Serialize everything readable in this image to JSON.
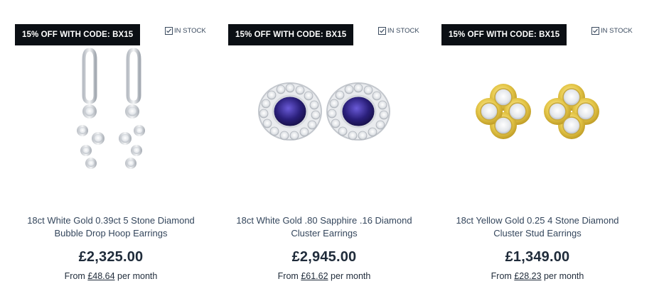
{
  "products": [
    {
      "badge": "15% OFF WITH CODE: BX15",
      "stock": "IN STOCK",
      "title_line1": "18ct White Gold 0.39ct 5 Stone Diamond",
      "title_line2": "Bubble Drop Hoop Earrings",
      "price": "£2,325.00",
      "finance_prefix": "From",
      "finance_amount": "£48.64",
      "finance_suffix": "per month",
      "image_icon": "drop-hoop-earrings-icon"
    },
    {
      "badge": "15% OFF WITH CODE: BX15",
      "stock": "IN STOCK",
      "title_line1": "18ct White Gold .80 Sapphire .16 Diamond",
      "title_line2": "Cluster Earrings",
      "price": "£2,945.00",
      "finance_prefix": "From",
      "finance_amount": "£61.62",
      "finance_suffix": "per month",
      "image_icon": "sapphire-cluster-earrings-icon"
    },
    {
      "badge": "15% OFF WITH CODE: BX15",
      "stock": "IN STOCK",
      "title_line1": "18ct Yellow Gold 0.25 4 Stone Diamond",
      "title_line2": "Cluster Stud Earrings",
      "price": "£1,349.00",
      "finance_prefix": "From",
      "finance_amount": "£28.23",
      "finance_suffix": "per month",
      "image_icon": "yellow-gold-cluster-studs-icon"
    }
  ],
  "colors": {
    "badge_bg": "#0b0f14",
    "text": "#243448",
    "sapphire": "#2a1f7a",
    "gold": "#e6c84a"
  }
}
